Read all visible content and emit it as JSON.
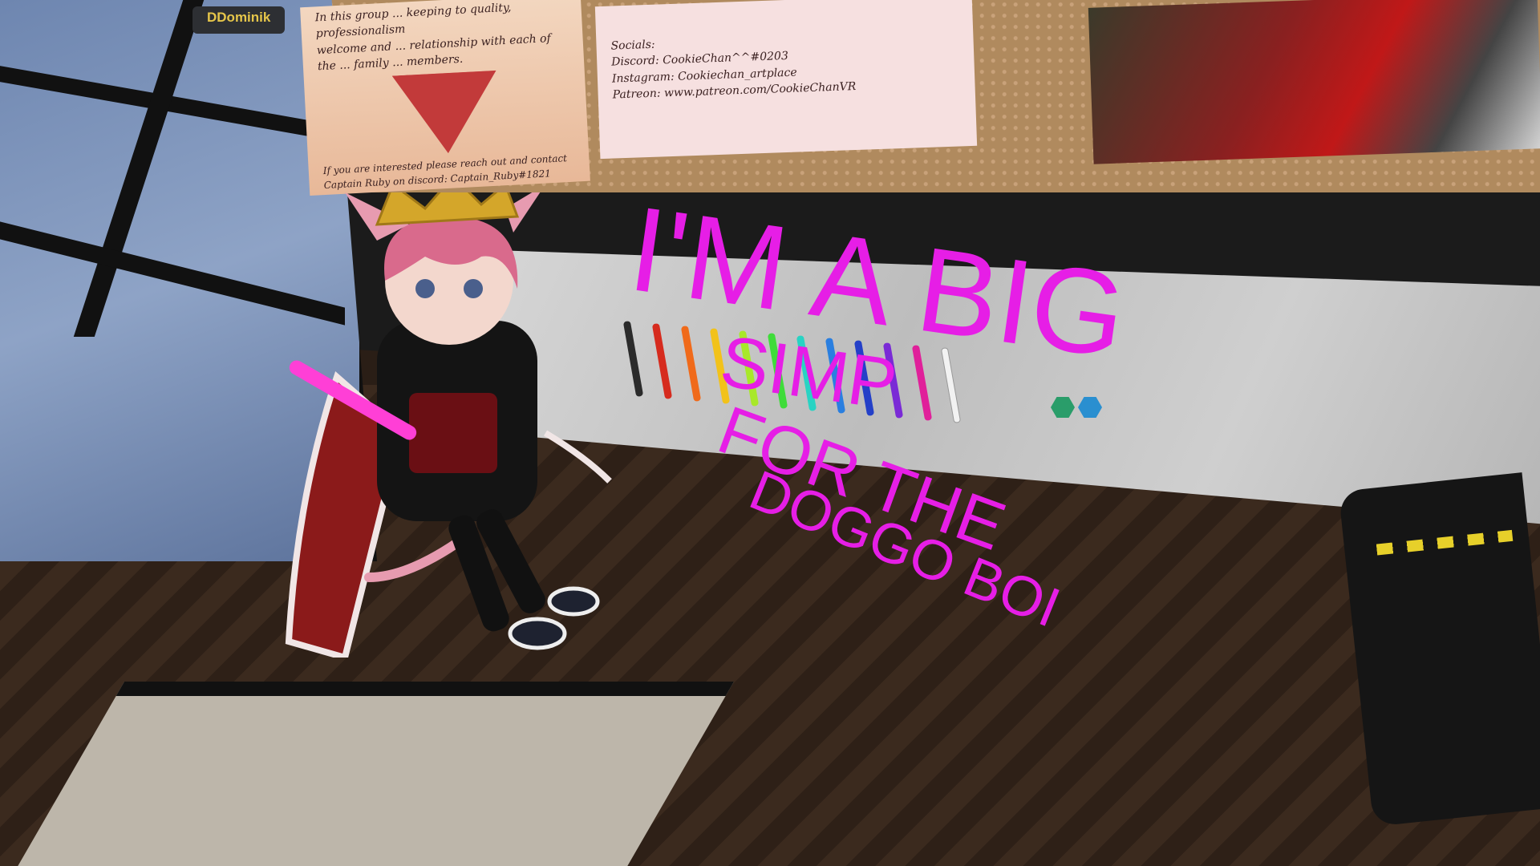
{
  "hud": {
    "nameplate": "DDominik"
  },
  "posters": {
    "rules_poster": {
      "lines": [
        "In this group ... keeping to quality, professionalism",
        "welcome and ... relationship with each of",
        "the ... family ... members."
      ],
      "footer": "If you are interested please reach out and contact Captain Ruby on discord: Captain_Ruby#1821"
    },
    "socials_poster": {
      "heading": "Socials:",
      "discord": "Discord: CookieChan^^#0203",
      "instagram": "Instagram: Cookiechan_artplace",
      "patreon": "Patreon: www.patreon.com/CookieChanVR"
    }
  },
  "doodle": {
    "lines": [
      "I'M A BIG",
      "SIMP",
      "FOR THE",
      "DOGGO BOI"
    ],
    "color": "#e61ee6"
  },
  "pens": [
    {
      "color": "#2b2b2b"
    },
    {
      "color": "#d62b1e"
    },
    {
      "color": "#f06a1a"
    },
    {
      "color": "#f2c21a"
    },
    {
      "color": "#a8e82a"
    },
    {
      "color": "#3fdc3a"
    },
    {
      "color": "#29d3c3"
    },
    {
      "color": "#2a7fe0"
    },
    {
      "color": "#2440c8"
    },
    {
      "color": "#7a2ad6"
    },
    {
      "color": "#e0209a"
    },
    {
      "color": "#f2f2f2"
    }
  ],
  "hexes": [
    {
      "color": "#2a9d6a"
    },
    {
      "color": "#2a8fd0"
    }
  ],
  "colors": {
    "crown": "#d4a62a",
    "hair": "#d96a8c",
    "hoodie": "#141414",
    "cape": "#8b1a1a",
    "held_pen": "#ff3fd6"
  }
}
